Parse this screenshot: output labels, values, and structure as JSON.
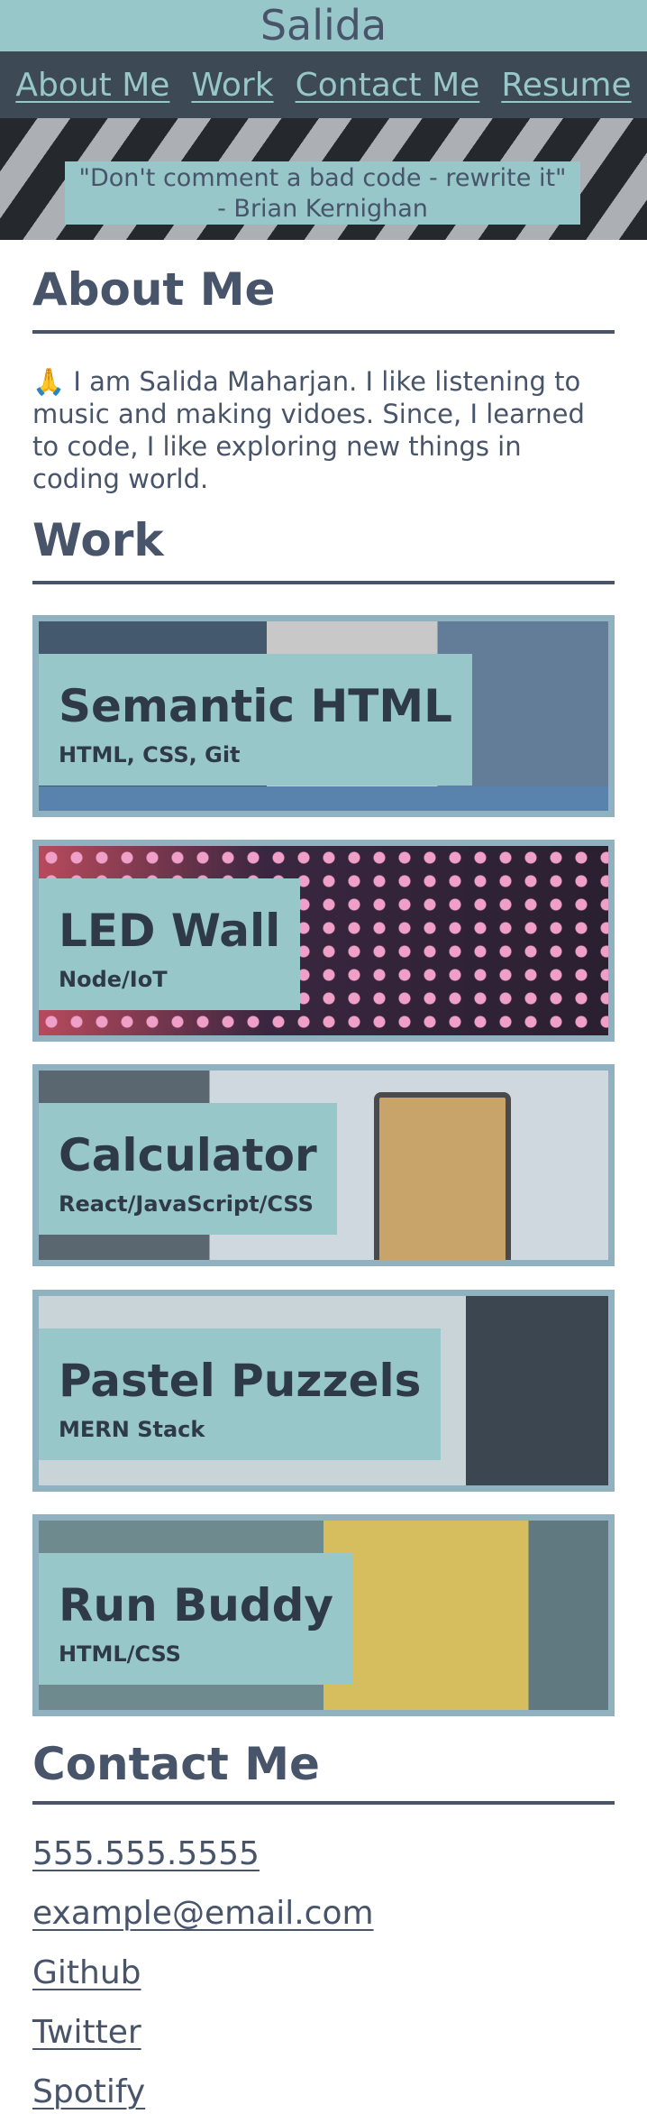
{
  "header": {
    "title": "Salida"
  },
  "nav": {
    "items": [
      "About Me",
      "Work",
      "Contact Me",
      "Resume"
    ]
  },
  "hero": {
    "quote_line1": "\"Don't comment a bad code - rewrite it\"",
    "quote_line2": "- Brian Kernighan"
  },
  "about": {
    "heading": "About Me",
    "emoji": "🙏",
    "text": "I am Salida Maharjan. I like listening to music and making vidoes. Since, I learned to code, I like exploring new things in coding world."
  },
  "work": {
    "heading": "Work",
    "projects": [
      {
        "title": "Semantic HTML",
        "tech": "HTML, CSS, Git"
      },
      {
        "title": "LED Wall",
        "tech": "Node/IoT"
      },
      {
        "title": "Calculator",
        "tech": "React/JavaScript/CSS"
      },
      {
        "title": "Pastel Puzzels",
        "tech": "MERN Stack"
      },
      {
        "title": "Run Buddy",
        "tech": "HTML/CSS"
      }
    ]
  },
  "contact": {
    "heading": "Contact Me",
    "links": [
      "555.555.5555",
      "example@email.com",
      "Github",
      "Twitter",
      "Spotify"
    ]
  }
}
